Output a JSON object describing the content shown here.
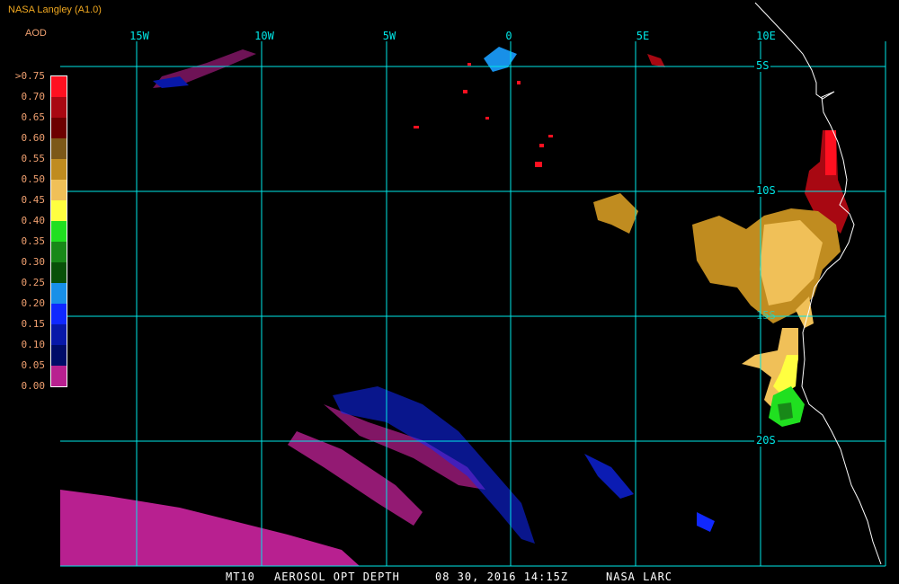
{
  "header": {
    "title": "NASA Langley (A1.0)",
    "subtitle": "AOD"
  },
  "legend": {
    "labels": [
      ">0.75",
      "0.70",
      "0.65",
      "0.60",
      "0.55",
      "0.50",
      "0.45",
      "0.40",
      "0.35",
      "0.30",
      "0.25",
      "0.20",
      "0.15",
      "0.10",
      "0.05",
      "0.00"
    ],
    "colors": [
      "#ff1020",
      "#a80812",
      "#6c0000",
      "#7c5818",
      "#c08c20",
      "#f0c058",
      "#ffff40",
      "#20e020",
      "#188818",
      "#085008",
      "#1890e8",
      "#1028ff",
      "#0818a8",
      "#000c68",
      "#b82090"
    ]
  },
  "grid": {
    "longitudes": [
      "15W",
      "10W",
      "5W",
      "0",
      "5E",
      "10E"
    ],
    "latitudes": [
      "5S",
      "10S",
      "15S",
      "20S"
    ],
    "color": "#00e8e8"
  },
  "caption": {
    "product_id": "MT10",
    "product": "AEROSOL OPT DEPTH",
    "datetime": "08 30, 2016 14:15Z",
    "source": "NASA LARC"
  }
}
